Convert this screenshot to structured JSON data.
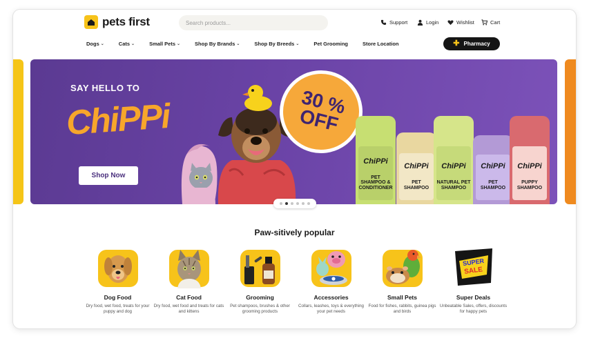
{
  "header": {
    "logo_text": "pets first",
    "search_placeholder": "Search products...",
    "support": "Support",
    "login": "Login",
    "wishlist": "Wishlist",
    "cart": "Cart"
  },
  "nav": {
    "items": [
      {
        "label": "Dogs",
        "dropdown": true
      },
      {
        "label": "Cats",
        "dropdown": true
      },
      {
        "label": "Small Pets",
        "dropdown": true
      },
      {
        "label": "Shop By Brands",
        "dropdown": true
      },
      {
        "label": "Shop By Breeds",
        "dropdown": true
      },
      {
        "label": "Pet Grooming",
        "dropdown": false
      },
      {
        "label": "Store Location",
        "dropdown": false
      }
    ],
    "pharmacy": "Pharmacy"
  },
  "hero": {
    "eyebrow": "SAY HELLO TO",
    "brand": "ChiPPi",
    "cta": "Shop Now",
    "badge_line1": "30 %",
    "badge_line2": "OFF",
    "bottles": [
      {
        "brand": "ChiPPi",
        "name": "PET SHAMPOO & CONDITIONER",
        "color": "#b9d06a"
      },
      {
        "brand": "ChiPPi",
        "name": "PET SHAMPOO",
        "color": "#e6d7a6"
      },
      {
        "brand": "ChiPPi",
        "name": "NATURAL PET SHAMPOO",
        "color": "#c6da7a"
      },
      {
        "brand": "ChiPPi",
        "name": "PET SHAMPOO",
        "color": "#b9a6dc"
      },
      {
        "brand": "ChiPPi",
        "name": "PUPPY SHAMPOO",
        "color": "#f2b3a8"
      }
    ],
    "slide_count": 6,
    "active_slide": 2
  },
  "categories": {
    "title": "Paw-sitively popular",
    "items": [
      {
        "name": "Dog Food",
        "desc": "Dry food, wet food, treats for your puppy and dog",
        "icon": "dog-icon"
      },
      {
        "name": "Cat Food",
        "desc": "Dry food, wet food and treats for cats and kittens",
        "icon": "cat-icon"
      },
      {
        "name": "Grooming",
        "desc": "Pet shampoos, brushes & other grooming products",
        "icon": "grooming-icon"
      },
      {
        "name": "Accessories",
        "desc": "Collars, leashes, toys & everything your pet needs",
        "icon": "accessories-icon"
      },
      {
        "name": "Small Pets",
        "desc": "Food for fishes, rabbits, guinea pigs and birds",
        "icon": "small-pets-icon"
      },
      {
        "name": "Super Deals",
        "desc": "Unbeatable Sales, offers, discounts for happy pets",
        "icon": "super-sale-icon"
      }
    ],
    "super_sale_badge": "SUPER SALE"
  },
  "colors": {
    "accent": "#f7c31a",
    "hero_bg": "#6a43a6",
    "brand_orange": "#f7a62b",
    "dark": "#151515"
  }
}
